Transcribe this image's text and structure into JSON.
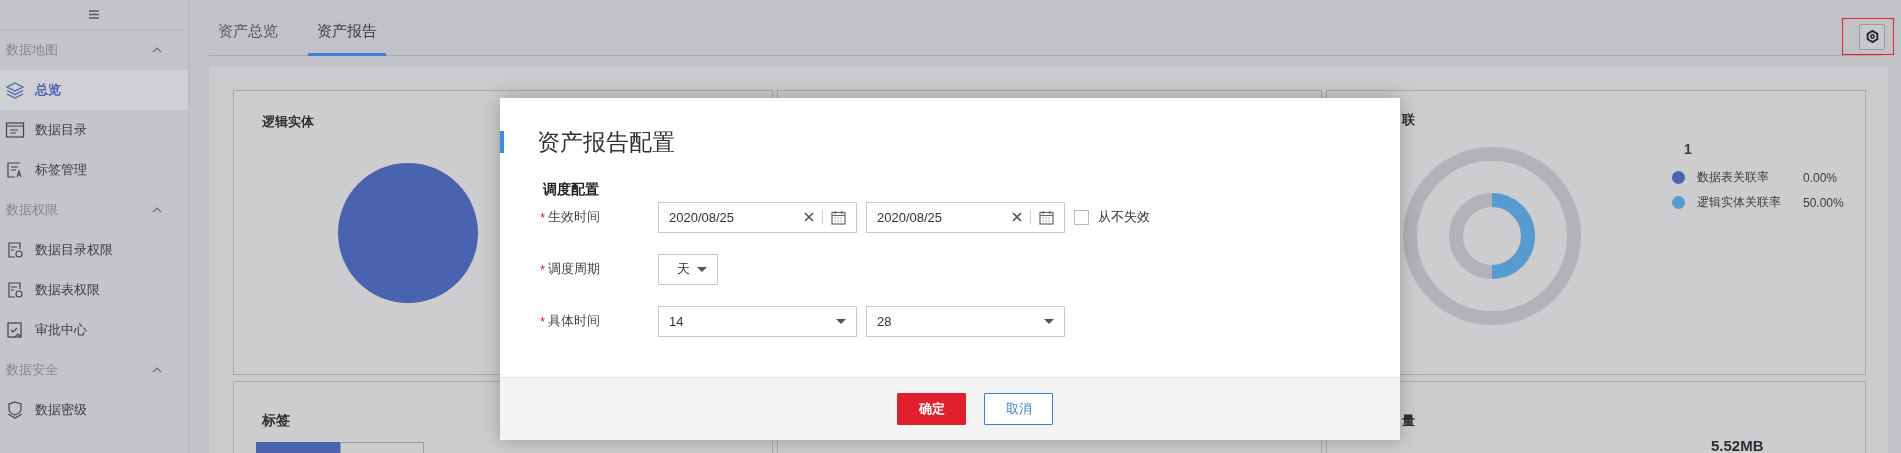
{
  "sidebar": {
    "groups": [
      {
        "label": "数据地图",
        "expanded": true,
        "children": [
          {
            "label": "总览",
            "selected": true
          },
          {
            "label": "数据目录",
            "selected": false
          },
          {
            "label": "标签管理",
            "selected": false
          }
        ]
      },
      {
        "label": "数据权限",
        "expanded": true,
        "children": [
          {
            "label": "数据目录权限",
            "selected": false
          },
          {
            "label": "数据表权限",
            "selected": false
          },
          {
            "label": "审批中心",
            "selected": false
          }
        ]
      },
      {
        "label": "数据安全",
        "expanded": true,
        "children": [
          {
            "label": "数据密级",
            "selected": false
          }
        ]
      }
    ]
  },
  "tabs": [
    {
      "label": "资产总览",
      "selected": false
    },
    {
      "label": "资产报告",
      "selected": true
    }
  ],
  "cards": {
    "entity": {
      "title": "逻辑实体"
    },
    "association": {
      "title": "联",
      "total": "1",
      "legend": [
        {
          "label": "数据表关联率",
          "value": "0.00%",
          "color": "#4a63b0"
        },
        {
          "label": "逻辑实体关联率",
          "value": "50.00%",
          "color": "#569cd0"
        }
      ]
    },
    "tags": {
      "title": "标签",
      "segments": [
        {
          "selected": true
        },
        {
          "selected": false
        }
      ]
    },
    "volume": {
      "title": "量",
      "value": "5.52MB"
    }
  },
  "dialog": {
    "title": "资产报告配置",
    "section": "调度配置",
    "fields": [
      {
        "kind": "date_range",
        "label": "生效时间",
        "required_mark": "*",
        "start": "2020/08/25",
        "end": "2020/08/25",
        "checkbox": {
          "label": "从不失效",
          "checked": false
        }
      },
      {
        "kind": "select",
        "label": "调度周期",
        "required_mark": "*",
        "value": "天"
      },
      {
        "kind": "select_pair",
        "label": "具体时间",
        "required_mark": "*",
        "values": [
          "14",
          "28"
        ]
      }
    ],
    "buttons": [
      {
        "kind": "primary",
        "label": "确定"
      },
      {
        "kind": "secondary",
        "label": "取消"
      }
    ]
  }
}
